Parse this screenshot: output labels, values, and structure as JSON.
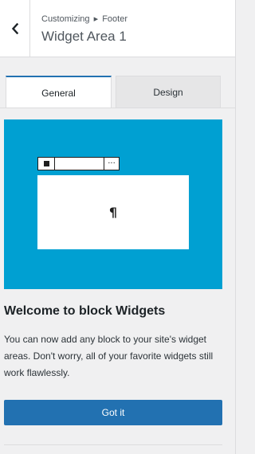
{
  "header": {
    "breadcrumb_parent": "Customizing",
    "breadcrumb_separator": "▸",
    "breadcrumb_current": "Footer",
    "title": "Widget Area 1",
    "back_icon": "chevron-left-icon"
  },
  "tabs": [
    {
      "label": "General",
      "active": true
    },
    {
      "label": "Design",
      "active": false
    }
  ],
  "illustration": {
    "background_color": "#00a0d2",
    "block_symbol": "¶",
    "toolbar_more": "···"
  },
  "welcome": {
    "heading": "Welcome to block Widgets",
    "body": "You can now add any block to your site's widget areas. Don't worry, all of your favorite widgets still work flawlessly."
  },
  "actions": {
    "got_it_label": "Got it",
    "accent_color": "#2271b1"
  }
}
